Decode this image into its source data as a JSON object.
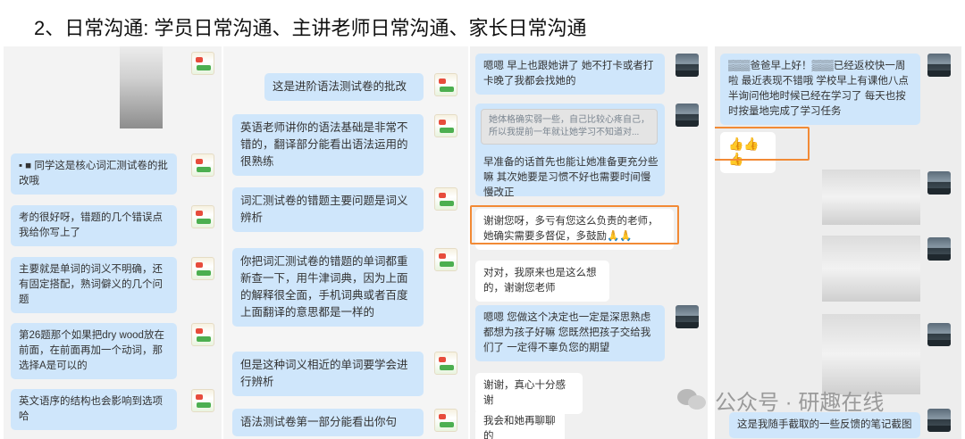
{
  "heading": "2、日常沟通: 学员日常沟通、主讲老师日常沟通、家长日常沟通",
  "panel1": {
    "messages": [
      "▪ ■ 同学这是核心词汇测试卷的批改哦",
      "考的很好呀，错题的几个错误点我给你写上了",
      "主要就是单词的词义不明确，还有固定搭配，熟词僻义的几个问题",
      "第26题那个如果把dry wood放在前面，在前面再加一个动词，那选择A是可以的",
      "英文语序的结构也会影响到选项哈"
    ]
  },
  "panel2": {
    "messages": [
      "这是进阶语法测试卷的批改",
      "英语老师讲你的语法基础是非常不错的，翻译部分能看出语法运用的很熟练",
      "词汇测试卷的错题主要问题是词义辨析",
      "你把词汇测试卷的错题的单词都重新查一下，用牛津词典，因为上面的解释很全面，手机词典或者百度上面翻译的意思都是一样的",
      "但是这种词义相近的单词要学会进行辨析",
      "语法测试卷第一部分能看出你句"
    ]
  },
  "panel3": {
    "messages": [
      "嗯嗯 早上也跟她讲了 她不打卡或者打卡晚了我都会找她的",
      "她体格确实弱一些，自己比较心疼自己，所以我提前一年就让她学习不知道对...",
      "早准备的话首先也能让她准备更充分些嘛 其次她要是习惯不好也需要时间慢慢改正",
      "谢谢您呀，多亏有您这么负责的老师，她确实需要多督促，多鼓励🙏🙏",
      "对对，我原来也是这么想的，谢谢您老师",
      "嗯嗯 您做这个决定也一定是深思熟虑 都想为孩子好嘛 您既然把孩子交给我们了 一定得不辜负您的期望",
      "谢谢，真心十分感谢",
      "我会和她再聊聊的"
    ]
  },
  "panel4": {
    "messages": [
      "▒▒▒爸爸早上好！▒▒▒已经返校快一周啦 最近表现不错哦 学校早上有课他八点半询问他地时候已经在学习了 每天也按时按量地完成了学习任务",
      "👍👍👍",
      "这是我随手截取的一些反馈的笔记截图"
    ]
  },
  "watermark": "公众号 · 研趣在线",
  "colors": {
    "student_bubble": "#cfe6fb",
    "received_bubble": "#ffffff",
    "highlight_border": "#f28a35"
  },
  "icons": [
    "book-avatar-icon",
    "landscape-avatar-icon",
    "wechat-icon",
    "thumbs-up-icon"
  ]
}
